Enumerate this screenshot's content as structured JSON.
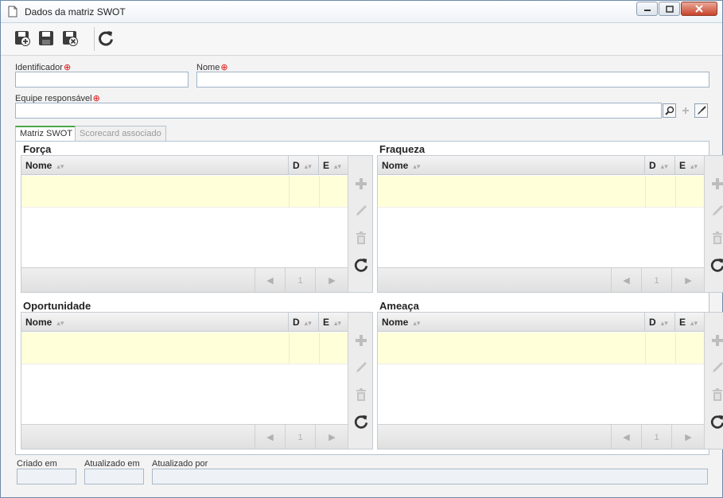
{
  "window": {
    "title": "Dados da matriz SWOT"
  },
  "toolbar": {
    "buttons": [
      {
        "name": "save-and-new-button",
        "icon": "save-plus-icon"
      },
      {
        "name": "save-button",
        "icon": "save-icon"
      },
      {
        "name": "save-and-close-button",
        "icon": "save-close-icon"
      },
      {
        "name": "refresh-button",
        "icon": "refresh-icon"
      }
    ]
  },
  "form": {
    "identificador": {
      "label": "Identificador",
      "value": ""
    },
    "nome": {
      "label": "Nome",
      "value": ""
    },
    "equipe": {
      "label": "Equipe responsável",
      "value": ""
    }
  },
  "tabs": [
    {
      "label": "Matriz SWOT",
      "active": true
    },
    {
      "label": "Scorecard associado",
      "active": false
    }
  ],
  "quadrants": [
    {
      "title": "Força",
      "columns": [
        "Nome",
        "D",
        "E"
      ],
      "page": "1"
    },
    {
      "title": "Fraqueza",
      "columns": [
        "Nome",
        "D",
        "E"
      ],
      "page": "1"
    },
    {
      "title": "Oportunidade",
      "columns": [
        "Nome",
        "D",
        "E"
      ],
      "page": "1"
    },
    {
      "title": "Ameaça",
      "columns": [
        "Nome",
        "D",
        "E"
      ],
      "page": "1"
    }
  ],
  "footer": {
    "criado_em": {
      "label": "Criado em",
      "value": ""
    },
    "atualizado_em": {
      "label": "Atualizado em",
      "value": ""
    },
    "atualizado_por": {
      "label": "Atualizado por",
      "value": ""
    }
  },
  "colors": {
    "accent": "#4aa84a",
    "required": "#dd1111",
    "row_highlight": "#ffffd9"
  }
}
